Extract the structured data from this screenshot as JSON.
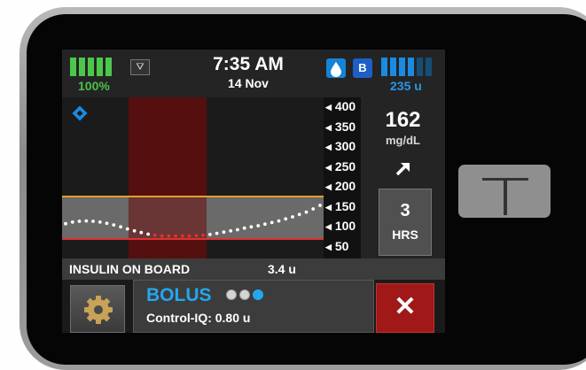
{
  "status": {
    "battery_label": "100%",
    "time": "7:35 AM",
    "date": "14 Nov",
    "badge_b": "B",
    "insulin_remaining": "235 u",
    "signal_symbol": "⛛"
  },
  "chart_data": {
    "type": "line",
    "y_ticks": [
      "400",
      "350",
      "300",
      "250",
      "200",
      "150",
      "100",
      "50"
    ],
    "ylim": [
      50,
      400
    ],
    "target_high": 180,
    "target_low": 70,
    "series": [
      {
        "x": [
          0,
          1,
          2,
          3,
          4,
          5,
          6,
          7,
          8,
          9,
          10,
          11,
          12,
          13,
          14,
          15,
          16,
          17,
          18,
          19,
          20,
          21,
          22,
          23,
          24,
          25,
          26,
          27,
          28,
          29,
          30,
          31,
          32,
          33,
          34,
          35,
          36,
          37
        ],
        "values": [
          106,
          110,
          112,
          113,
          112,
          110,
          107,
          103,
          98,
          93,
          88,
          84,
          80,
          77,
          75,
          75,
          75,
          75,
          75,
          76,
          77,
          79,
          82,
          85,
          88,
          91,
          95,
          98,
          101,
          105,
          109,
          113,
          118,
          123,
          129,
          135,
          143,
          152
        ]
      }
    ],
    "colors": {
      "low_series": "#e03030",
      "normal_series": "#ffffff",
      "target_high_line": "#e0a030",
      "target_low_line": "#e03030",
      "event_band": "#5a0e0e"
    }
  },
  "bg": {
    "value": "162",
    "unit": "mg/dL",
    "trend_icon": "arrow-up-right"
  },
  "range_button": {
    "number": "3",
    "label": "HRS"
  },
  "iob": {
    "label": "INSULIN ON BOARD",
    "value": "3.4 u"
  },
  "bolus": {
    "label": "BOLUS",
    "control_iq": "Control-IQ: 0.80 u",
    "dots_active_index": 2
  },
  "cancel": {
    "symbol": "✕"
  },
  "colors": {
    "accent_blue": "#23a7ef",
    "battery_green": "#48c048",
    "cancel_red": "#a01818"
  }
}
